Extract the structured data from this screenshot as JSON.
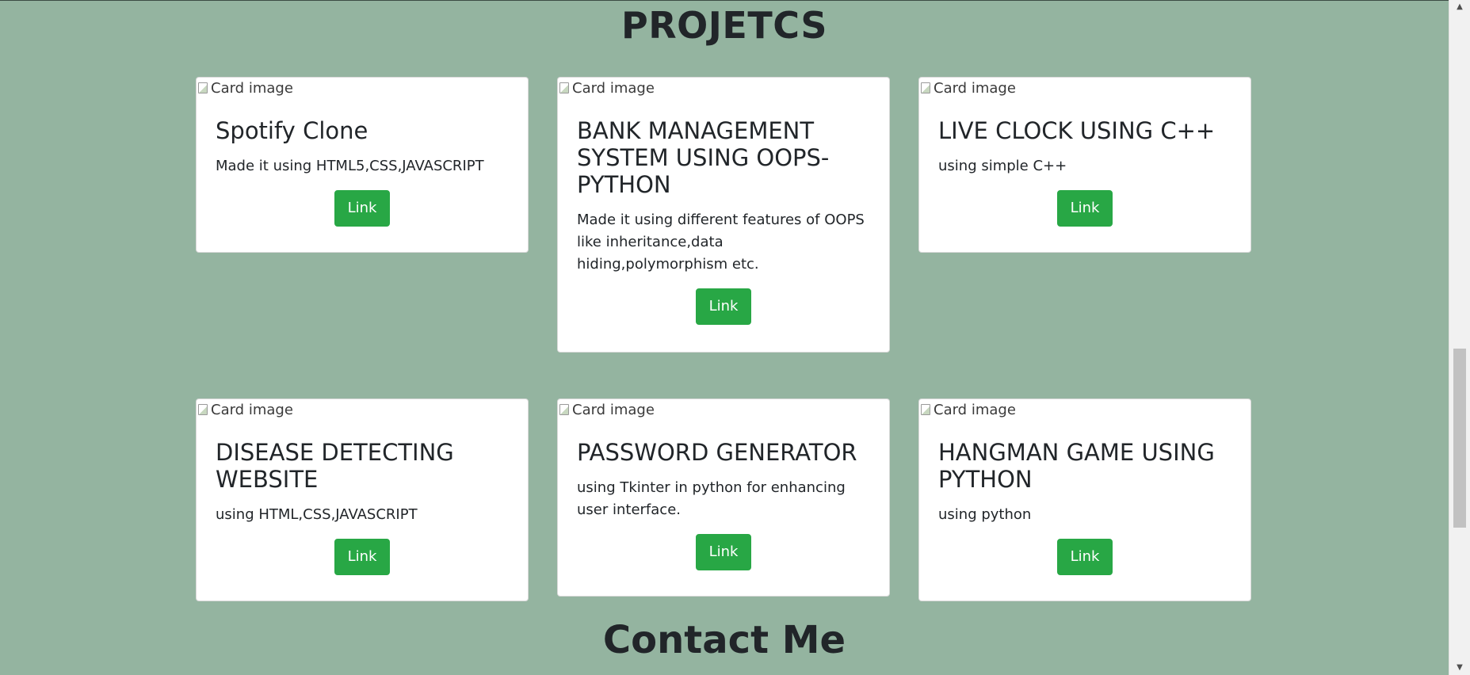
{
  "sections": {
    "projects_title": "PROJETCS",
    "contact_title": "Contact Me"
  },
  "cards": [
    {
      "image_alt": "Card image",
      "title": "Spotify Clone",
      "text": "Made it using HTML5,CSS,JAVASCRIPT",
      "button": "Link"
    },
    {
      "image_alt": "Card image",
      "title": "BANK MANAGEMENT SYSTEM USING OOPS-PYTHON",
      "text": "Made it using different features of OOPS like inheritance,data hiding,polymorphism etc.",
      "button": "Link"
    },
    {
      "image_alt": "Card image",
      "title": "LIVE CLOCK USING C++",
      "text": "using simple C++",
      "button": "Link"
    },
    {
      "image_alt": "Card image",
      "title": "DISEASE DETECTING WEBSITE",
      "text": "using HTML,CSS,JAVASCRIPT",
      "button": "Link"
    },
    {
      "image_alt": "Card image",
      "title": "PASSWORD GENERATOR",
      "text": "using Tkinter in python for enhancing user interface.",
      "button": "Link"
    },
    {
      "image_alt": "Card image",
      "title": "HANGMAN GAME USING PYTHON",
      "text": "using python",
      "button": "Link"
    }
  ],
  "scrollbar": {
    "up_icon": "triangle-up-icon",
    "down_icon": "triangle-down-icon",
    "position_fraction": 0.55
  },
  "colors": {
    "background": "#94b4a0",
    "card": "#ffffff",
    "button": "#28a745",
    "text": "#212529"
  }
}
